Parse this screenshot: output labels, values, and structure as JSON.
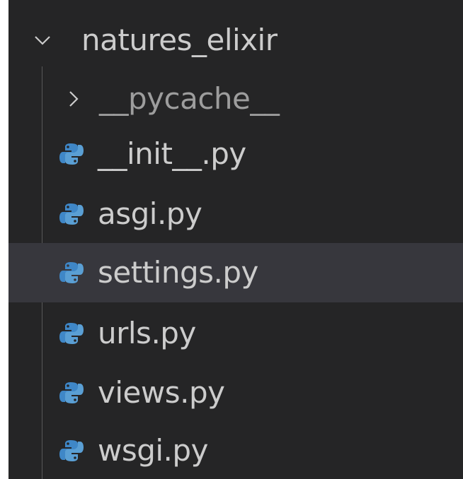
{
  "explorer": {
    "root_folder": {
      "label": "natures_elixir",
      "expanded": true,
      "chevron_icon": "chevron-down-icon"
    },
    "subfolders": [
      {
        "label": "__pycache__",
        "expanded": false,
        "chevron_icon": "chevron-right-icon"
      }
    ],
    "files": [
      {
        "label": "__init__.py",
        "icon": "python-file-icon",
        "selected": false
      },
      {
        "label": "asgi.py",
        "icon": "python-file-icon",
        "selected": false
      },
      {
        "label": "settings.py",
        "icon": "python-file-icon",
        "selected": true
      },
      {
        "label": "urls.py",
        "icon": "python-file-icon",
        "selected": false
      },
      {
        "label": "views.py",
        "icon": "python-file-icon",
        "selected": false
      },
      {
        "label": "wsgi.py",
        "icon": "python-file-icon",
        "selected": false
      }
    ]
  },
  "colors": {
    "background": "#252526",
    "text": "#cccccc",
    "dim_text": "#9d9d9d",
    "hover_row": "#37373d",
    "python_blue": "#3f87c7",
    "python_light": "#5a9fd4"
  }
}
